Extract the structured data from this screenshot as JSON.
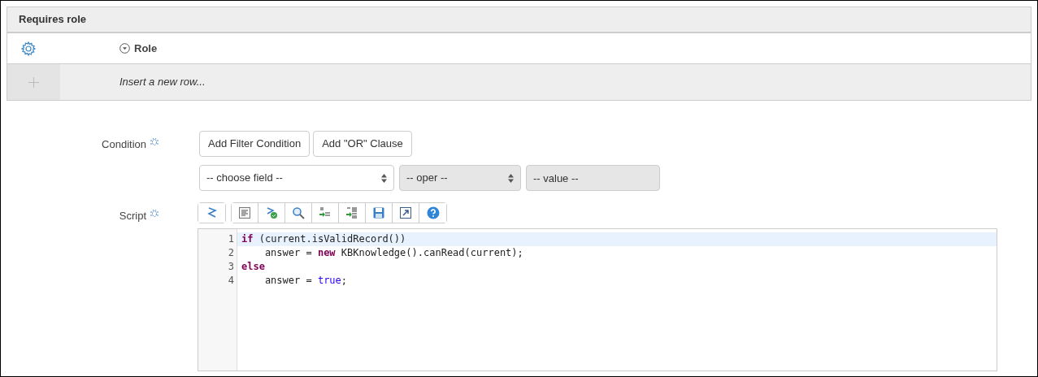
{
  "panel": {
    "title": "Requires role",
    "column": "Role",
    "insert_row": "Insert a new row..."
  },
  "condition": {
    "label": "Condition",
    "buttons": [
      "Add Filter Condition",
      "Add \"OR\" Clause"
    ],
    "selects": [
      {
        "value": "-- choose field --",
        "disabled": false,
        "kind": "select"
      },
      {
        "value": "-- oper --",
        "disabled": true,
        "kind": "select"
      },
      {
        "value": "-- value --",
        "disabled": true,
        "kind": "input"
      }
    ]
  },
  "script": {
    "label": "Script",
    "lines": [
      {
        "number": "1",
        "selected": true,
        "tokens": [
          {
            "kind": "keyword",
            "text": "if"
          },
          {
            "kind": "plain",
            "text": " (current.isValidRecord())"
          }
        ]
      },
      {
        "number": "2",
        "selected": false,
        "tokens": [
          {
            "kind": "plain",
            "text": "    answer = "
          },
          {
            "kind": "keyword",
            "text": "new"
          },
          {
            "kind": "plain",
            "text": " KBKnowledge().canRead(current);"
          }
        ]
      },
      {
        "number": "3",
        "selected": false,
        "tokens": [
          {
            "kind": "keyword",
            "text": "else"
          }
        ]
      },
      {
        "number": "4",
        "selected": false,
        "tokens": [
          {
            "kind": "plain",
            "text": "    answer = "
          },
          {
            "kind": "literal",
            "text": "true"
          },
          {
            "kind": "plain",
            "text": ";"
          }
        ]
      }
    ]
  }
}
